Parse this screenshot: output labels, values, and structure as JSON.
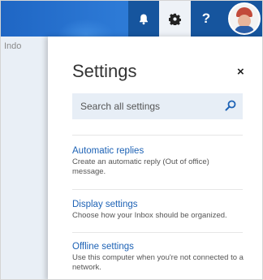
{
  "left_pane": {
    "partial_label": "Indo"
  },
  "header": {
    "icons": [
      "bell-icon",
      "gear-icon",
      "help-icon",
      "avatar"
    ],
    "help_label": "?"
  },
  "settings": {
    "title": "Settings",
    "close_label": "×",
    "search": {
      "placeholder": "Search all settings"
    },
    "items": [
      {
        "title": "Automatic replies",
        "description": "Create an automatic reply (Out of office) message."
      },
      {
        "title": "Display settings",
        "description": "Choose how your Inbox should be organized."
      },
      {
        "title": "Offline settings",
        "description": "Use this computer when you're not connected to a network."
      }
    ]
  },
  "colors": {
    "topbar_blue": "#2a78d3",
    "active_button": "#16559e",
    "link_blue": "#1d62b5",
    "search_bg": "#e7eef6"
  }
}
